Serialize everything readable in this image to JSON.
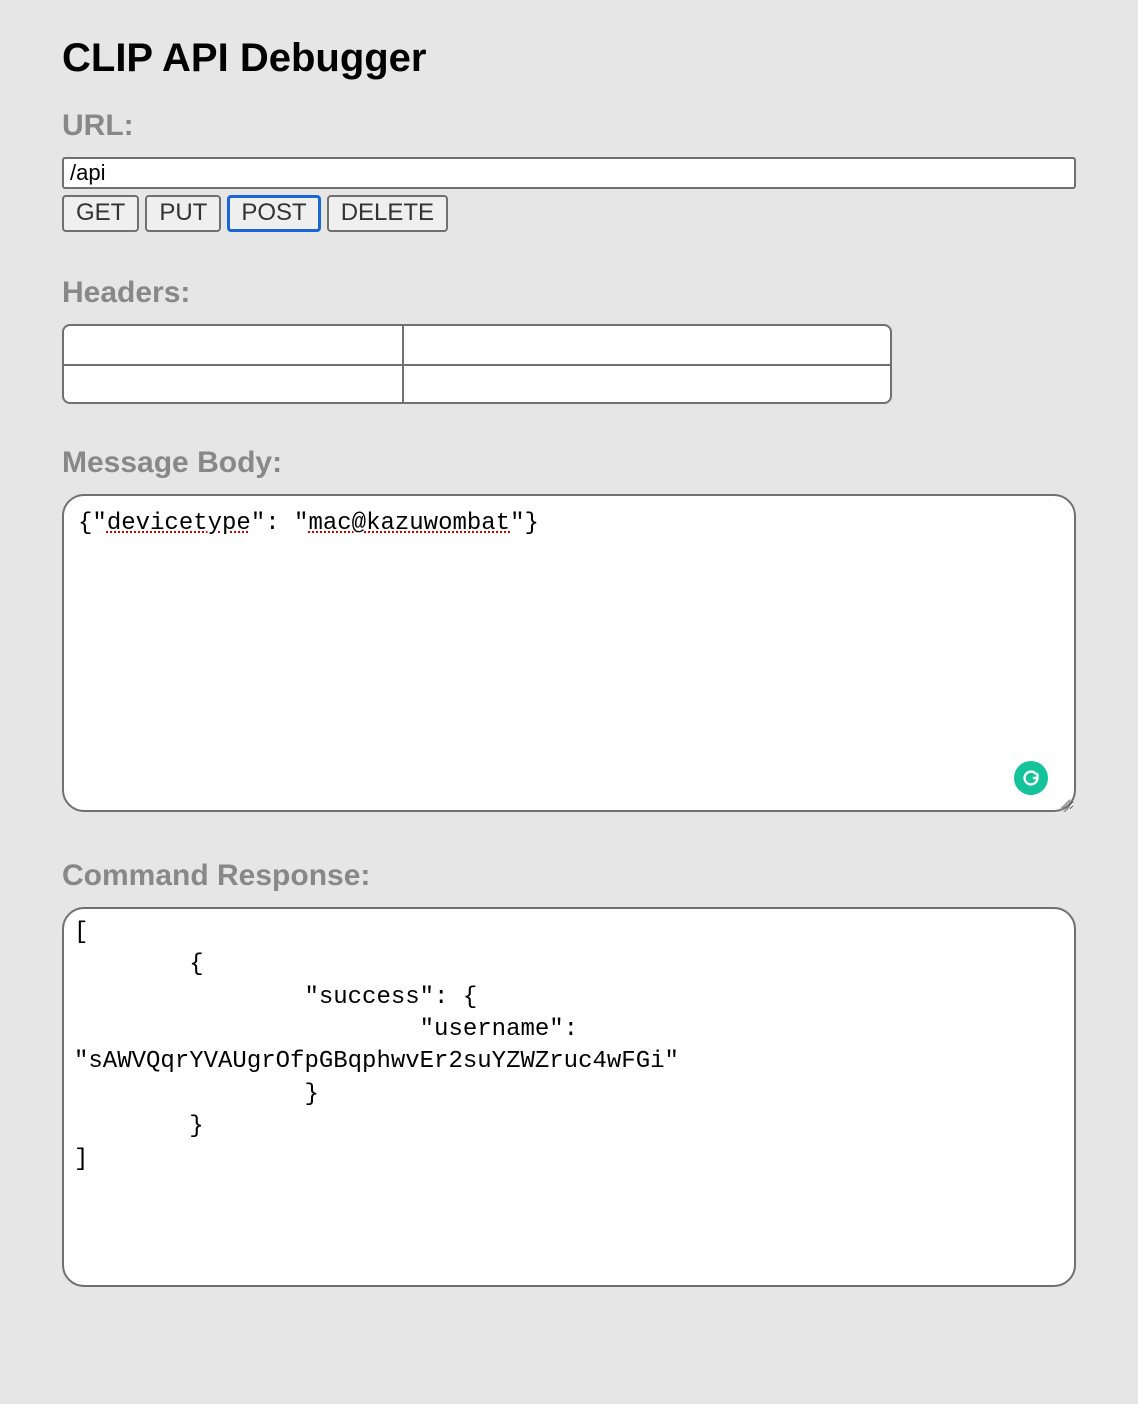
{
  "page": {
    "title": "CLIP API Debugger"
  },
  "sections": {
    "url": "URL:",
    "headers": "Headers:",
    "body": "Message Body:",
    "response": "Command Response:"
  },
  "url": {
    "value": "/api"
  },
  "methods": {
    "get": "GET",
    "put": "PUT",
    "post": "POST",
    "delete": "DELETE",
    "active": "post"
  },
  "headers_table": {
    "rows": [
      {
        "key": "",
        "value": ""
      },
      {
        "key": "",
        "value": ""
      }
    ]
  },
  "body": {
    "text_plain": "{\"devicetype\": \"mac@kazuwombat\"}",
    "spell_tokens": {
      "prefix": "{\"",
      "word1": "devicetype",
      "mid": "\": \"",
      "word2": "mac@kazuwombat",
      "suffix": "\"}"
    }
  },
  "response": {
    "text": "[\n        {\n                \"success\": {\n                        \"username\":\n\"sAWVQqrYVAUgrOfpGBqphwvEr2suYZWZruc4wFGi\"\n                }\n        }\n]"
  },
  "icons": {
    "grammarly": "grammarly-icon"
  }
}
